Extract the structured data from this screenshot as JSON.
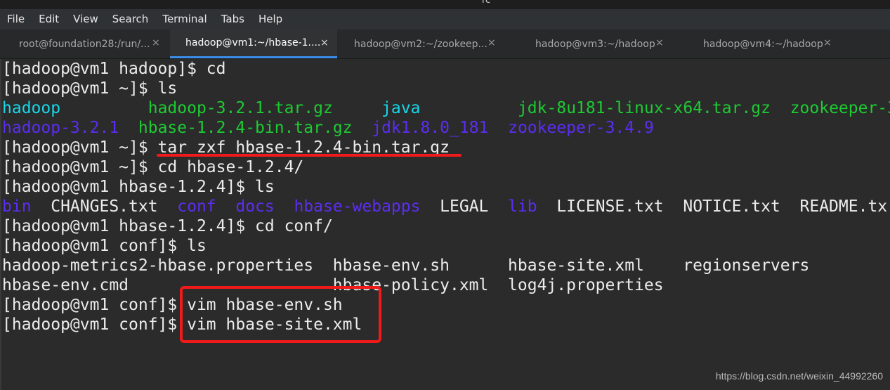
{
  "window": {
    "title": "rc"
  },
  "menu": [
    "File",
    "Edit",
    "View",
    "Search",
    "Terminal",
    "Tabs",
    "Help"
  ],
  "tabs": [
    {
      "label": "root@foundation28:/run/...",
      "close": "×",
      "active": false
    },
    {
      "label": "hadoop@vm1:~/hbase-1....",
      "close": "×",
      "active": true
    },
    {
      "label": "hadoop@vm2:~/zookeep...",
      "close": "×",
      "active": false
    },
    {
      "label": "hadoop@vm3:~/hadoop",
      "close": "×",
      "active": false
    },
    {
      "label": "hadoop@vm4:~/hadoop",
      "close": "×",
      "active": false
    }
  ],
  "terminal": {
    "colors": {
      "directory": "#5c2df2",
      "archive": "#1ecb33",
      "link": "#18d7ea",
      "text": "#ececec",
      "annotation": "#ef1a1a"
    },
    "lines": [
      [
        {
          "t": "[hadoop@vm1 hadoop]$ cd",
          "c": "white"
        }
      ],
      [
        {
          "t": "[hadoop@vm1 ~]$ ls",
          "c": "white"
        }
      ],
      [
        {
          "t": "hadoop",
          "c": "cyan"
        },
        {
          "t": "         ",
          "c": "white"
        },
        {
          "t": "hadoop-3.2.1.tar.gz",
          "c": "green"
        },
        {
          "t": "     ",
          "c": "white"
        },
        {
          "t": "java",
          "c": "cyan"
        },
        {
          "t": "          ",
          "c": "white"
        },
        {
          "t": "jdk-8u181-linux-x64.tar.gz",
          "c": "green"
        },
        {
          "t": "  ",
          "c": "white"
        },
        {
          "t": "zookeeper-3",
          "c": "green"
        }
      ],
      [
        {
          "t": "hadoop-3.2.1",
          "c": "blue"
        },
        {
          "t": "  ",
          "c": "white"
        },
        {
          "t": "hbase-1.2.4-bin.tar.gz",
          "c": "green"
        },
        {
          "t": "  ",
          "c": "white"
        },
        {
          "t": "jdk1.8.0_181",
          "c": "blue"
        },
        {
          "t": "  ",
          "c": "white"
        },
        {
          "t": "zookeeper-3.4.9",
          "c": "blue"
        }
      ],
      [
        {
          "t": "[hadoop@vm1 ~]$ tar zxf hbase-1.2.4-bin.tar.gz",
          "c": "white"
        }
      ],
      [
        {
          "t": "[hadoop@vm1 ~]$ cd hbase-1.2.4/",
          "c": "white"
        }
      ],
      [
        {
          "t": "[hadoop@vm1 hbase-1.2.4]$ ls",
          "c": "white"
        }
      ],
      [
        {
          "t": "bin",
          "c": "blue"
        },
        {
          "t": "  CHANGES.txt  ",
          "c": "white"
        },
        {
          "t": "conf",
          "c": "blue"
        },
        {
          "t": "  ",
          "c": "white"
        },
        {
          "t": "docs",
          "c": "blue"
        },
        {
          "t": "  ",
          "c": "white"
        },
        {
          "t": "hbase-webapps",
          "c": "blue"
        },
        {
          "t": "  LEGAL  ",
          "c": "white"
        },
        {
          "t": "lib",
          "c": "blue"
        },
        {
          "t": "  LICENSE.txt  NOTICE.txt  README.tx",
          "c": "white"
        }
      ],
      [
        {
          "t": "[hadoop@vm1 hbase-1.2.4]$ cd conf/",
          "c": "white"
        }
      ],
      [
        {
          "t": "[hadoop@vm1 conf]$ ls",
          "c": "white"
        }
      ],
      [
        {
          "t": "hadoop-metrics2-hbase.properties  hbase-env.sh      hbase-site.xml    regionservers",
          "c": "white"
        }
      ],
      [
        {
          "t": "hbase-env.cmd                     hbase-policy.xml  log4j.properties",
          "c": "white"
        }
      ],
      [
        {
          "t": "[hadoop@vm1 conf]$ vim hbase-env.sh",
          "c": "white"
        }
      ],
      [
        {
          "t": "[hadoop@vm1 conf]$ vim hbase-site.xml",
          "c": "white"
        }
      ]
    ]
  },
  "watermark": "https://blog.csdn.net/weixin_44992260"
}
